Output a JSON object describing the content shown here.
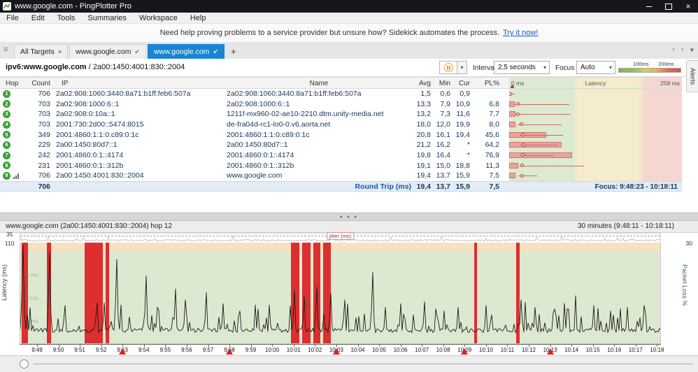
{
  "window": {
    "title": "www.google.com - PingPlotter Pro"
  },
  "icons": {
    "close": "×",
    "check": "✔",
    "dropdown": "▾",
    "plus": "+",
    "menu_list": "≡",
    "scroll_left": "‹",
    "scroll_right": "›",
    "scroll_down": "▾",
    "dots": "● ● ●",
    "chevron_right_big": "›"
  },
  "menu": {
    "items": [
      "File",
      "Edit",
      "Tools",
      "Summaries",
      "Workspace",
      "Help"
    ]
  },
  "banner": {
    "text": "Need help proving problems to a service provider but unsure how? Sidekick automates the process.",
    "link": "Try it now!"
  },
  "tabs": [
    {
      "label": "All Targets",
      "icon": "close",
      "active": false
    },
    {
      "label": "www.google.com",
      "icon": "check",
      "active": false
    },
    {
      "label": "www.google.com",
      "icon": "check",
      "active": true
    }
  ],
  "target_bar": {
    "target_bold": "ipv6:www.google.com",
    "target_rest": " / 2a00:1450:4001:830::2004",
    "interval_label": "Interval",
    "interval_value": "2,5 seconds",
    "focus_label": "Focus",
    "focus_value": "Auto",
    "legend_labels": [
      "100ms",
      "200ms"
    ]
  },
  "alerts_label": "Alerts",
  "table": {
    "headers": [
      "Hop",
      "Count",
      "IP",
      "Name",
      "Avg",
      "Min",
      "Cur",
      "PL%"
    ],
    "latency_header": {
      "left": "0 ms",
      "center": "Latency",
      "right": "258 ms"
    },
    "latency_axis_max_ms": 258,
    "rows": [
      {
        "hop": "1",
        "count": "706",
        "ip": "2a02:908:1060:3440:8a71:b1ff:feb6:507a",
        "name": "2a02:908:1060:3440:8a71:b1ff:feb6:507a",
        "avg": "1,5",
        "min": "0,6",
        "cur": "0,9",
        "pl": "",
        "avg_ms": 1.5,
        "min_ms": 0.6,
        "max_ms": 8,
        "pl_pct": 0,
        "graphed": false
      },
      {
        "hop": "2",
        "count": "703",
        "ip": "2a02:908:1000:6::1",
        "name": "2a02:908:1000:6::1",
        "avg": "13,3",
        "min": "7,9",
        "cur": "10,9",
        "pl": "6,8",
        "avg_ms": 13.3,
        "min_ms": 7.9,
        "max_ms": 90,
        "pl_pct": 6.8,
        "graphed": false
      },
      {
        "hop": "3",
        "count": "703",
        "ip": "2a02:908:0:10a::1",
        "name": "1211f-mx960-02-ae10-2210.dtm.unity-media.net",
        "avg": "13,2",
        "min": "7,3",
        "cur": "11,6",
        "pl": "7,7",
        "avg_ms": 13.2,
        "min_ms": 7.3,
        "max_ms": 92,
        "pl_pct": 7.7,
        "graphed": false
      },
      {
        "hop": "4",
        "count": "703",
        "ip": "2001:730:2d00::5474:8015",
        "name": "de-fra04d-rc1-lo0-0.v6.aorta.net",
        "avg": "18,0",
        "min": "12,0",
        "cur": "19,9",
        "pl": "8,0",
        "avg_ms": 18.0,
        "min_ms": 12.0,
        "max_ms": 78,
        "pl_pct": 8.0,
        "graphed": false
      },
      {
        "hop": "5",
        "count": "349",
        "ip": "2001:4860:1:1:0:c89:0:1c",
        "name": "2001:4860:1:1:0:c89:0:1c",
        "avg": "20,8",
        "min": "16,1",
        "cur": "19,4",
        "pl": "45,6",
        "avg_ms": 20.8,
        "min_ms": 16.1,
        "max_ms": 80,
        "pl_pct": 45.6,
        "graphed": false
      },
      {
        "hop": "6",
        "count": "229",
        "ip": "2a00:1450:80d7::1",
        "name": "2a00:1450:80d7::1",
        "avg": "21,2",
        "min": "16,2",
        "cur": "*",
        "pl": "64,2",
        "avg_ms": 21.2,
        "min_ms": 16.2,
        "max_ms": 72,
        "pl_pct": 64.2,
        "graphed": false
      },
      {
        "hop": "7",
        "count": "242",
        "ip": "2001:4860:0:1::4174",
        "name": "2001:4860:0:1::4174",
        "avg": "19,8",
        "min": "16,4",
        "cur": "*",
        "pl": "76,9",
        "avg_ms": 19.8,
        "min_ms": 16.4,
        "max_ms": 66,
        "pl_pct": 76.9,
        "graphed": false
      },
      {
        "hop": "8",
        "count": "231",
        "ip": "2001:4860:0:1::312b",
        "name": "2001:4860:0:1::312b",
        "avg": "19,1",
        "min": "15,0",
        "cur": "18,8",
        "pl": "11,3",
        "avg_ms": 19.1,
        "min_ms": 15.0,
        "max_ms": 112,
        "pl_pct": 11.3,
        "graphed": false
      },
      {
        "hop": "9",
        "count": "706",
        "ip": "2a00:1450:4001:830::2004",
        "name": "www.google.com",
        "avg": "19,4",
        "min": "13,7",
        "cur": "15,9",
        "pl": "7,5",
        "avg_ms": 19.4,
        "min_ms": 13.7,
        "max_ms": 42,
        "pl_pct": 7.5,
        "graphed": true
      }
    ],
    "footer": {
      "count": "706",
      "label": "Round Trip (ms)",
      "avg": "19,4",
      "min": "13,7",
      "cur": "15,9",
      "pl": "7,5",
      "focus": "Focus: 9:48:23 - 10:18:11"
    }
  },
  "chart_data": {
    "type": "line",
    "title": "www.google.com (2a00:1450:4001:830::2004) hop 12",
    "range_label": "30 minutes (9:48:11 - 10:18:11)",
    "start_time": "9:48:11",
    "end_time": "10:18:11",
    "duration_min": 30,
    "ylabel": "Latency (ms)",
    "y2label": "Packet Loss %",
    "jitter_label": "jitter (ms)",
    "jitter_scale_max": 35,
    "latency_scale_max": 110,
    "packet_loss_scale_max": 30,
    "warn_threshold_ms": 100,
    "baseline_ms": 15,
    "grid": false,
    "x_ticks": [
      "9:49",
      "9:50",
      "9:51",
      "9:52",
      "9:53",
      "9:54",
      "9:55",
      "9:56",
      "9:57",
      "9:58",
      "9:59",
      "10:00",
      "10:01",
      "10:02",
      "10:03",
      "10:04",
      "10:05",
      "10:06",
      "10:07",
      "10:08",
      "10:09",
      "10:10",
      "10:11",
      "10:12",
      "10:13",
      "10:14",
      "10:15",
      "10:16",
      "10:17",
      "10:18"
    ],
    "inner_gridline_labels": [
      "75 ms",
      "50 ms",
      "25 ms"
    ],
    "latency_spikes_min_ms": [
      [
        0.15,
        108
      ],
      [
        1.35,
        100
      ],
      [
        2.1,
        42
      ],
      [
        3.95,
        45
      ],
      [
        4.5,
        92
      ],
      [
        5.9,
        74
      ],
      [
        6.4,
        40
      ],
      [
        7.25,
        60
      ],
      [
        7.7,
        48
      ],
      [
        8.7,
        56
      ],
      [
        9.5,
        44
      ],
      [
        10.3,
        36
      ],
      [
        11.1,
        38
      ],
      [
        12.8,
        58
      ],
      [
        13.3,
        52
      ],
      [
        13.9,
        62
      ],
      [
        14.5,
        55
      ],
      [
        15.2,
        48
      ],
      [
        16.5,
        78
      ],
      [
        17.1,
        40
      ],
      [
        17.8,
        44
      ],
      [
        18.9,
        46
      ],
      [
        19.8,
        36
      ],
      [
        20.5,
        40
      ],
      [
        21.8,
        42
      ],
      [
        23.4,
        48
      ],
      [
        24.1,
        40
      ],
      [
        24.9,
        34
      ],
      [
        25.6,
        38
      ],
      [
        26.8,
        42
      ],
      [
        27.6,
        36
      ],
      [
        28.4,
        40
      ],
      [
        29.2,
        42
      ]
    ],
    "packet_loss_events_min": [
      [
        0.05,
        0.3
      ],
      [
        1.25,
        0.18
      ],
      [
        3.0,
        0.85
      ],
      [
        4.0,
        0.15
      ],
      [
        12.65,
        0.42
      ],
      [
        13.18,
        0.4
      ],
      [
        13.7,
        0.33
      ],
      [
        14.16,
        0.36
      ],
      [
        21.22,
        0.16
      ],
      [
        23.18,
        0.19
      ]
    ],
    "alert_markers": [
      "9:53",
      "9:58",
      "10:03",
      "10:09",
      "10:13"
    ],
    "colors": {
      "loss_bar": "#dd2f2f",
      "latency_line": "#1c1c1c",
      "ok_zone": "#dce9d0",
      "warn_zone": "#f5e2c0"
    }
  },
  "colors": {
    "accent_blue": "#1786d2",
    "hop_green": "#3aa23a",
    "loss_red": "#dd2f2f",
    "titlebar": "#16171c"
  }
}
